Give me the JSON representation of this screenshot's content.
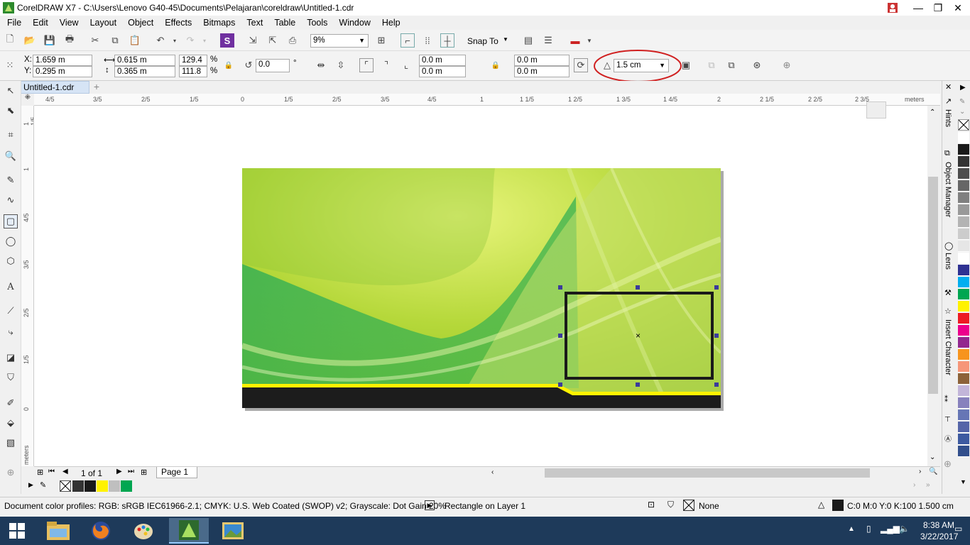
{
  "title_bar": {
    "text": "CorelDRAW X7 - C:\\Users\\Lenovo G40-45\\Documents\\Pelajaran\\coreldraw\\Untitled-1.cdr"
  },
  "menu": [
    "File",
    "Edit",
    "View",
    "Layout",
    "Object",
    "Effects",
    "Bitmaps",
    "Text",
    "Table",
    "Tools",
    "Window",
    "Help"
  ],
  "toolbar": {
    "zoom": "9%",
    "snap_to": "Snap To"
  },
  "property_bar": {
    "x_label": "X:",
    "x": "1.659 m",
    "y_label": "Y:",
    "y": "0.295 m",
    "width": "0.615 m",
    "height": "0.365 m",
    "scale_w": "129.4",
    "scale_h": "111.8",
    "pct1": "%",
    "pct2": "%",
    "rotation": "0.0",
    "deg": "°",
    "corner1": "0.0 m",
    "corner2": "0.0 m",
    "corner3": "0.0 m",
    "corner4": "0.0 m",
    "outline_width": "1.5 cm"
  },
  "doc_tab": "Untitled-1.cdr",
  "ruler_h": [
    "4/5",
    "3/5",
    "2/5",
    "1/5",
    "0",
    "1/5",
    "2/5",
    "3/5",
    "4/5",
    "1",
    "1 1/5",
    "1 2/5",
    "1 3/5",
    "1 4/5",
    "2",
    "2 1/5",
    "2 2/5",
    "2 3/5",
    "meters"
  ],
  "ruler_v": [
    "1 1/5",
    "1",
    "4/5",
    "3/5",
    "2/5",
    "1/5",
    "0",
    "meters"
  ],
  "page_nav": {
    "count": "1 of 1",
    "page_tab": "Page 1"
  },
  "docker_tabs": [
    "Hints",
    "Object Manager",
    "Lens",
    "Insert Character"
  ],
  "status": {
    "profiles": "Document color profiles: RGB: sRGB IEC61966-2.1; CMYK: U.S. Web Coated (SWOP) v2; Grayscale: Dot Gain 20%",
    "selection": "Rectangle on Layer 1",
    "fill": "None",
    "outline": "C:0 M:0 Y:0 K:100  1.500 cm"
  },
  "taskbar": {
    "time": "8:38 AM",
    "date": "3/22/2017"
  },
  "palette_colors": [
    "#ffffff",
    "#1a1a1a",
    "#333333",
    "#4d4d4d",
    "#666666",
    "#808080",
    "#999999",
    "#b3b3b3",
    "#cccccc",
    "#e6e6e6",
    "#ffffff",
    "#2e3192",
    "#00aeef",
    "#00a651",
    "#fff200",
    "#ed1c24",
    "#ec008c",
    "#92278f",
    "#f7941d",
    "#f69679",
    "#8c6239",
    "#c2b5d9",
    "#8781bd",
    "#6676b5",
    "#5565a8",
    "#3d5aa0",
    "#324f8c"
  ],
  "doc_palette": [
    "#333333",
    "#1a1a1a",
    "#fff200",
    "#bfbfbf",
    "#00a651"
  ]
}
